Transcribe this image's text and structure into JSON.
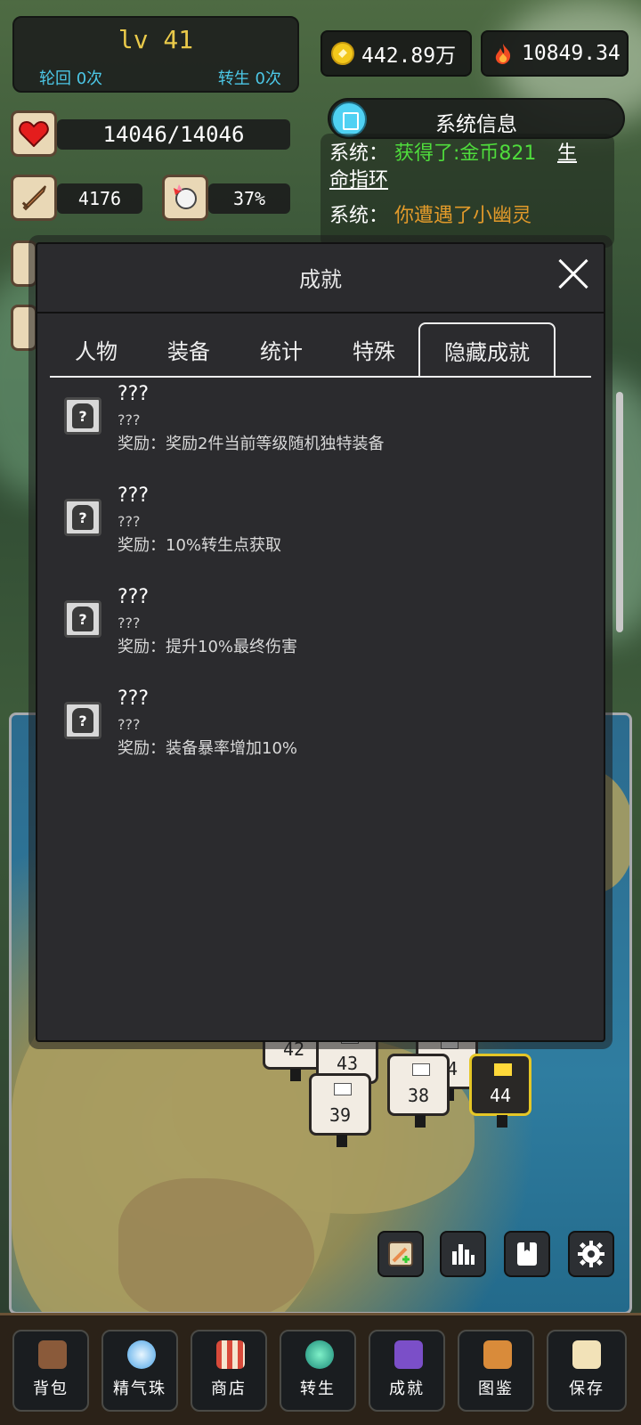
{
  "player": {
    "level": "lv 41",
    "reincarnation": "轮回 0次",
    "rebirth": "转生 0次"
  },
  "currency": {
    "gold": "442.89万",
    "power": "10849.34"
  },
  "stats": {
    "hp": "14046/14046",
    "attack": "4176",
    "crit": "37%"
  },
  "system": {
    "title": "系统信息",
    "lines": [
      {
        "prefix": "系统：",
        "text": "获得了:金币821",
        "extra": "生命指环"
      },
      {
        "prefix": "系统：",
        "text": "你遭遇了小幽灵"
      }
    ]
  },
  "modal": {
    "title": "成就",
    "tabs": [
      "人物",
      "装备",
      "统计",
      "特殊",
      "隐藏成就"
    ],
    "active_tab": "隐藏成就",
    "achievements": [
      {
        "name": "???",
        "desc": "???",
        "reward": "奖励：奖励2件当前等级随机独特装备"
      },
      {
        "name": "???",
        "desc": "???",
        "reward": "奖励：10%转生点获取"
      },
      {
        "name": "???",
        "desc": "???",
        "reward": "奖励：提升10%最终伤害"
      },
      {
        "name": "???",
        "desc": "???",
        "reward": "奖励：装备暴率增加10%"
      }
    ]
  },
  "map": {
    "markers": [
      "42",
      "43",
      "44",
      "39",
      "38",
      "44"
    ],
    "current_marker": "44"
  },
  "map_buttons": [
    "equip-compare-icon",
    "stats-chart-icon",
    "book-icon",
    "gear-icon"
  ],
  "nav": [
    "背包",
    "精气珠",
    "商店",
    "转生",
    "成就",
    "图鉴",
    "保存"
  ],
  "colors": {
    "accent_gold": "#e9c94a",
    "info_cyan": "#4cc7e6",
    "loot_green": "#4fdc3c",
    "event_orange": "#e29a2a"
  }
}
